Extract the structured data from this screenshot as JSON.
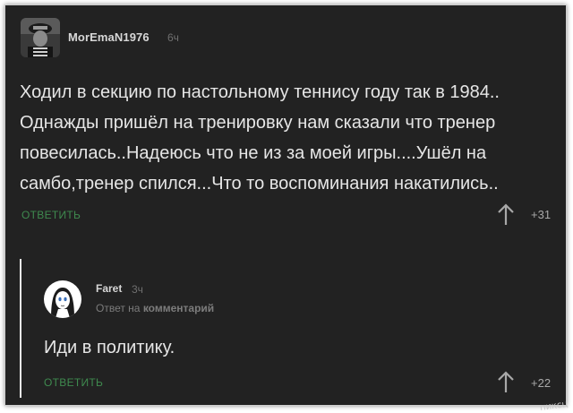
{
  "comment": {
    "user": {
      "name": "MorEmaN1976",
      "avatar_icon": "avatar-icon"
    },
    "time": "6ч",
    "text": "Ходил в секцию по настольному теннису году так в 1984.. Однажды пришёл на тренировку нам сказали что тренер повесилась..Надеюсь что не из за моей игры....Ушёл на самбо,тренер спился...Что то воспоминания накатились..",
    "reply_label": "ОТВЕТИТЬ",
    "rating": "+31",
    "vote_icon": "arrow-up-icon"
  },
  "reply": {
    "user": {
      "name": "Faret",
      "avatar_icon": "avatar-icon"
    },
    "time": "3ч",
    "reply_to_prefix": "Ответ на",
    "reply_to_target": "комментарий",
    "text": "Иди в политику.",
    "reply_label": "ОТВЕТИТЬ",
    "rating": "+22",
    "vote_icon": "arrow-up-icon"
  },
  "watermark": "пиксц",
  "colors": {
    "background": "#222222",
    "text": "#e6e6e6",
    "username": "#d7d7d7",
    "meta": "#6f6f6f",
    "reply_link": "#3f8a4f",
    "thread_line": "#ececec"
  }
}
